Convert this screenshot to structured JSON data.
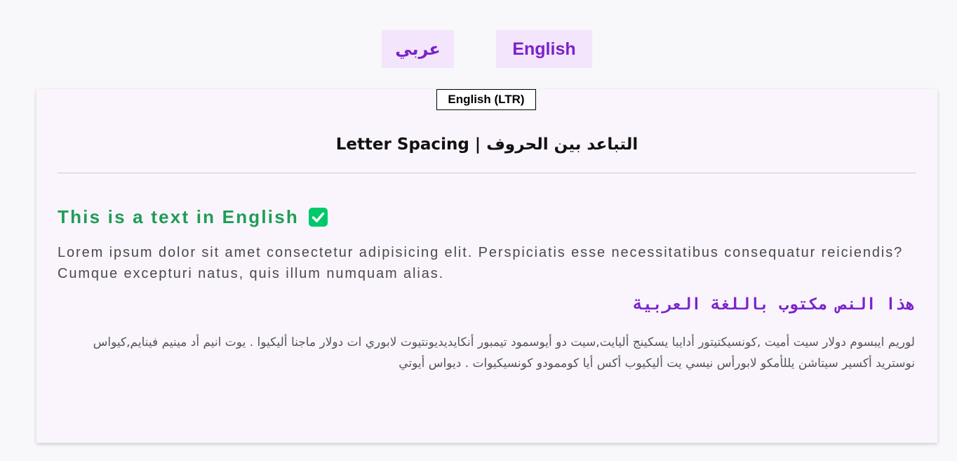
{
  "language_switcher": {
    "arabic_label": "عربي",
    "english_label": "English"
  },
  "card": {
    "direction_badge": "English (LTR)",
    "title": "Letter Spacing | التباعد بين الحروف",
    "english_heading": "This is a text in English",
    "english_paragraph": "Lorem ipsum dolor sit amet consectetur adipisicing elit. Perspiciatis esse necessitatibus consequatur reiciendis? Cumque excepturi natus, quis illum numquam alias.",
    "arabic_heading": "هذا النص مكتوب باللغة العربية",
    "arabic_paragraph": "لوريم ايبسوم دولار سيت أميت ,كونسيكتيتور أدايبا يسكينج أليايت,سيت دو أيوسمود تيمبور أنكايديديونتيوت لابوري ات دولار ماجنا أليكيوا . يوت انيم أد مينيم فينايم,كيواس نوستريد أكسير سيتاشن يللأمكو لابورأس نيسي يت أليكيوب أكس أيا كوممودو كونسيكيوات . ديواس أيوتي"
  },
  "colors": {
    "accent_purple": "#7b22c9",
    "success_green": "#1f9d55",
    "button_bg": "#f3e5fc",
    "card_bg": "#faf5fd"
  },
  "icons": {
    "heading_check": "check-square-icon"
  }
}
